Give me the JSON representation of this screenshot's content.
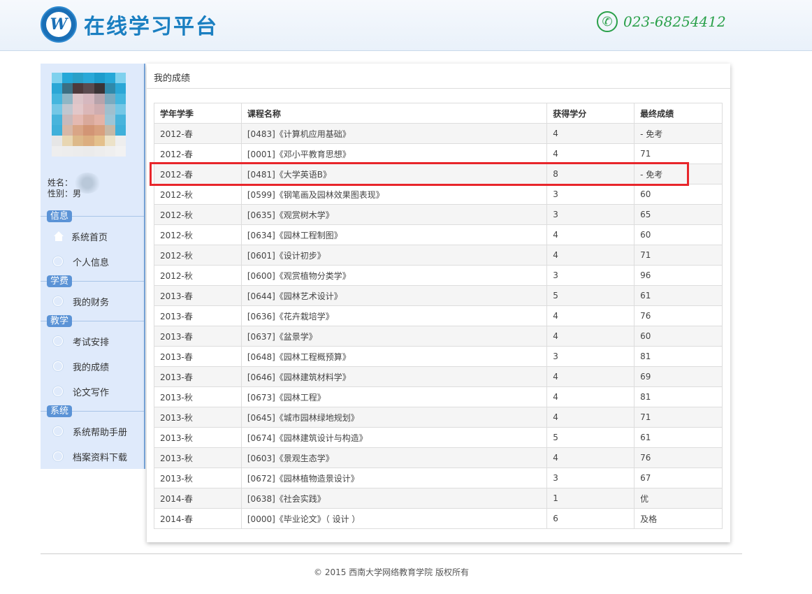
{
  "header": {
    "title": "在线学习平台",
    "phone": "023-68254412",
    "logo_glyph": "W"
  },
  "sidebar": {
    "name_label": "姓名：",
    "gender_label": "性别：",
    "gender_value": "男",
    "sections": [
      {
        "label": "信息",
        "items": [
          {
            "label": "系统首页"
          },
          {
            "label": "个人信息"
          }
        ]
      },
      {
        "label": "学费",
        "items": [
          {
            "label": "我的财务"
          }
        ]
      },
      {
        "label": "教学",
        "items": [
          {
            "label": "考试安排"
          },
          {
            "label": "我的成绩"
          },
          {
            "label": "论文写作"
          }
        ]
      },
      {
        "label": "系统",
        "items": [
          {
            "label": "系统帮助手册"
          },
          {
            "label": "档案资料下载"
          }
        ]
      }
    ]
  },
  "main": {
    "title": "我的成绩",
    "columns": [
      "学年学季",
      "课程名称",
      "获得学分",
      "最终成绩"
    ],
    "rows": [
      [
        "2012-春",
        "[0483]《计算机应用基础》",
        "4",
        "- 免考"
      ],
      [
        "2012-春",
        "[0001]《邓小平教育思想》",
        "4",
        "71"
      ],
      [
        "2012-春",
        "[0481]《大学英语B》",
        "8",
        "- 免考"
      ],
      [
        "2012-秋",
        "[0599]《钢笔画及园林效果图表现》",
        "3",
        "60"
      ],
      [
        "2012-秋",
        "[0635]《观赏树木学》",
        "3",
        "65"
      ],
      [
        "2012-秋",
        "[0634]《园林工程制图》",
        "4",
        "60"
      ],
      [
        "2012-秋",
        "[0601]《设计初步》",
        "4",
        "71"
      ],
      [
        "2012-秋",
        "[0600]《观赏植物分类学》",
        "3",
        "96"
      ],
      [
        "2013-春",
        "[0644]《园林艺术设计》",
        "5",
        "61"
      ],
      [
        "2013-春",
        "[0636]《花卉栽培学》",
        "4",
        "76"
      ],
      [
        "2013-春",
        "[0637]《盆景学》",
        "4",
        "60"
      ],
      [
        "2013-春",
        "[0648]《园林工程概预算》",
        "3",
        "81"
      ],
      [
        "2013-春",
        "[0646]《园林建筑材料学》",
        "4",
        "69"
      ],
      [
        "2013-秋",
        "[0673]《园林工程》",
        "4",
        "81"
      ],
      [
        "2013-秋",
        "[0645]《城市园林绿地规划》",
        "4",
        "71"
      ],
      [
        "2013-秋",
        "[0674]《园林建筑设计与构造》",
        "5",
        "61"
      ],
      [
        "2013-秋",
        "[0603]《景观生态学》",
        "4",
        "76"
      ],
      [
        "2013-秋",
        "[0672]《园林植物造景设计》",
        "3",
        "67"
      ],
      [
        "2014-春",
        "[0638]《社会实践》",
        "1",
        "优"
      ],
      [
        "2014-春",
        "[0000]《毕业论文》（ 设计 ）",
        "6",
        "及格"
      ]
    ]
  },
  "footer": {
    "copyright": "© 2015 西南大学网络教育学院 版权所有"
  }
}
